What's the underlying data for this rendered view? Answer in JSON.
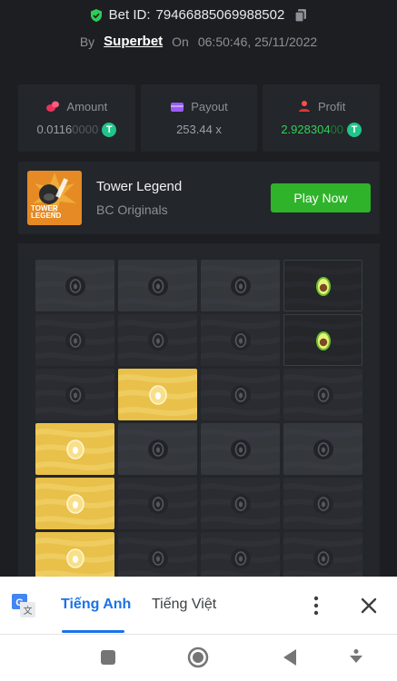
{
  "header": {
    "bet_label": "Bet ID:",
    "bet_id": "7946688506998 8502",
    "bet_id_text": "79466885069988502",
    "by_label": "By",
    "brand": "Superbet",
    "on_label": "On",
    "datetime": "06:50:46, 25/11/2022"
  },
  "stats": {
    "amount": {
      "label": "Amount",
      "value_main": "0.0116",
      "value_dim": "0000",
      "coin": "T"
    },
    "payout": {
      "label": "Payout",
      "value": "253.44 x"
    },
    "profit": {
      "label": "Profit",
      "value_main": "2.928304",
      "value_dim": "00",
      "coin": "T"
    }
  },
  "game": {
    "thumb_text_1": "TOWER",
    "thumb_text_2": "LEGEND",
    "title": "Tower Legend",
    "subtitle": "BC Originals",
    "play_label": "Play Now"
  },
  "board": {
    "rows": [
      [
        "light",
        "light",
        "light",
        "avocado"
      ],
      [
        "dark",
        "dark",
        "dark",
        "avocado"
      ],
      [
        "dark",
        "gold",
        "dark",
        "dark"
      ],
      [
        "gold",
        "light",
        "light",
        "light"
      ],
      [
        "gold",
        "dark",
        "dark",
        "dark"
      ],
      [
        "gold",
        "dark",
        "dark",
        "dark"
      ]
    ]
  },
  "translate": {
    "tab_active": "Tiếng Anh",
    "tab_other": "Tiếng Việt"
  },
  "colors": {
    "accent_green": "#2fb32a",
    "profit_green": "#2ed257",
    "gold": "#e8c04a",
    "google_blue": "#1a73e8"
  }
}
